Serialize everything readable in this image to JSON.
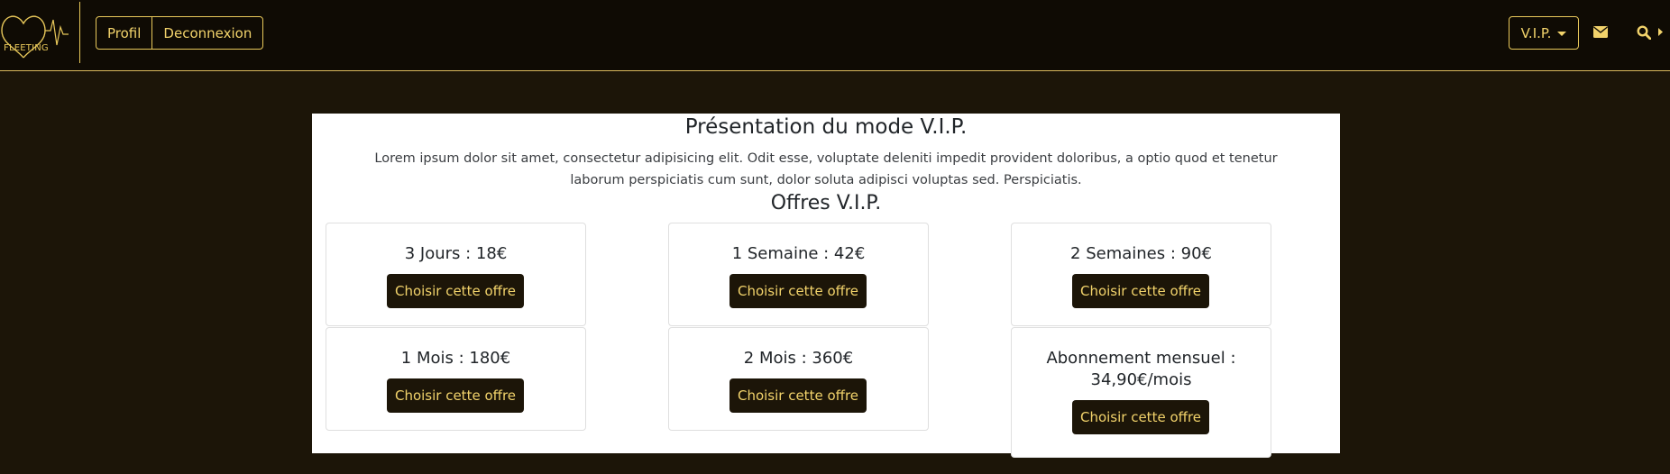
{
  "navbar": {
    "logo_text": "FLEETING",
    "profile_label": "Profil",
    "logout_label": "Deconnexion",
    "vip_label": "V.I.P.",
    "icons": [
      "heart-logo-icon",
      "envelope-icon",
      "search-icon",
      "chevron-right-icon"
    ]
  },
  "main": {
    "title": "Présentation du mode V.I.P.",
    "intro": "Lorem ipsum dolor sit amet, consectetur adipisicing elit. Odit esse, voluptate deleniti impedit provident doloribus, a optio quod et tenetur laborum perspiciatis cum sunt, dolor soluta adipisci voluptas sed. Perspiciatis.",
    "offers_title": "Offres V.I.P.",
    "offers": [
      {
        "title": "3 Jours : 18€",
        "button": "Choisir cette offre"
      },
      {
        "title": "1 Semaine : 42€",
        "button": "Choisir cette offre"
      },
      {
        "title": "2 Semaines : 90€",
        "button": "Choisir cette offre"
      },
      {
        "title": "1 Mois : 180€",
        "button": "Choisir cette offre"
      },
      {
        "title": "2 Mois : 360€",
        "button": "Choisir cette offre"
      },
      {
        "title": "Abonnement mensuel : 34,90€/mois",
        "button": "Choisir cette offre"
      }
    ]
  },
  "colors": {
    "background": "#1c1508",
    "navbar": "#0f0b04",
    "accent": "#f2d36b",
    "card_bg": "#ffffff"
  }
}
